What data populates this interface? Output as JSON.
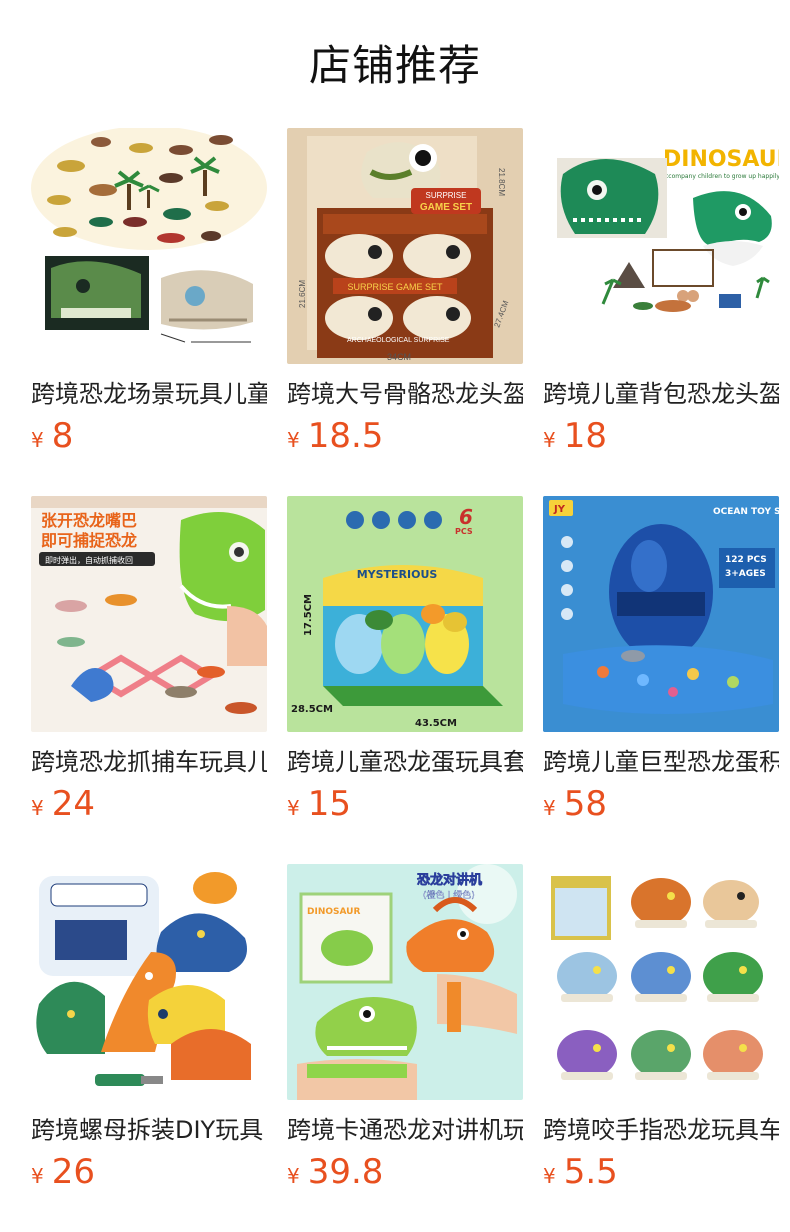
{
  "header": {
    "title": "店铺推荐"
  },
  "products": [
    {
      "title": "跨境恐龙场景玩具儿童",
      "currency": "¥",
      "price": "8",
      "image_text": []
    },
    {
      "title": "跨境大号骨骼恐龙头盔",
      "currency": "¥",
      "price": "18.5",
      "image_text": [
        "SURPRISE",
        "GAME SET",
        "34CM",
        "21.8CM",
        "21.6CM",
        "27.4CM",
        "ARCHAEOLOGICAL SURPRISE"
      ]
    },
    {
      "title": "跨境儿童背包恐龙头盔",
      "currency": "¥",
      "price": "18",
      "image_text": [
        "DINOSAUR",
        "Accompany children to grow up happily"
      ]
    },
    {
      "title": "跨境恐龙抓捕车玩具儿",
      "currency": "¥",
      "price": "24",
      "image_text": [
        "张开恐龙嘴巴",
        "即可捕捉恐龙",
        "即时弹出，自动抓捕收回"
      ]
    },
    {
      "title": "跨境儿童恐龙蛋玩具套",
      "currency": "¥",
      "price": "15",
      "image_text": [
        "6",
        "PCS",
        "MYSTERIOUS",
        "17.5CM",
        "28.5CM",
        "43.5CM"
      ]
    },
    {
      "title": "跨境儿童巨型恐龙蛋积",
      "currency": "¥",
      "price": "58",
      "image_text": [
        "JY",
        "OCEAN TOY SET",
        "122 PCS",
        "3+AGES"
      ]
    },
    {
      "title": "跨境螺母拆装DIY玩具",
      "currency": "¥",
      "price": "26",
      "image_text": []
    },
    {
      "title": "跨境卡通恐龙对讲机玩",
      "currency": "¥",
      "price": "39.8",
      "image_text": [
        "恐龙对讲机",
        "(橙色 | 绿色)",
        "DINOSAUR"
      ]
    },
    {
      "title": "跨境咬手指恐龙玩具车",
      "currency": "¥",
      "price": "5.5",
      "image_text": []
    }
  ]
}
